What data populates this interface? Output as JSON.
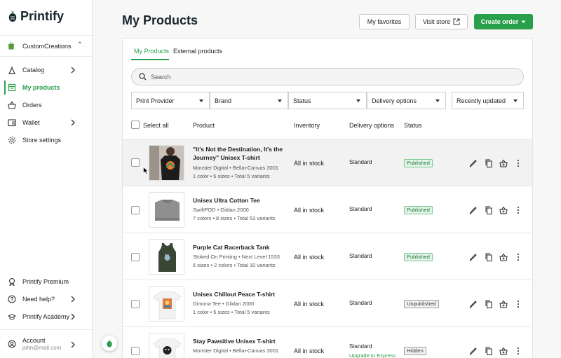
{
  "app": {
    "logo_text": "Printify"
  },
  "sidebar": {
    "store_name": "CustomCreations",
    "items": [
      {
        "label": "Catalog",
        "icon": "catalog-icon",
        "has_chevron": true
      },
      {
        "label": "My products",
        "icon": "products-icon",
        "active": true
      },
      {
        "label": "Orders",
        "icon": "basket-icon"
      },
      {
        "label": "Wallet",
        "icon": "wallet-icon",
        "has_chevron": true
      },
      {
        "label": "Store settings",
        "icon": "gear-icon"
      }
    ],
    "bottom_items": [
      {
        "label": "Printify Premium",
        "icon": "premium-icon"
      },
      {
        "label": "Need help?",
        "icon": "help-icon",
        "has_chevron": true
      },
      {
        "label": "Printify Academy",
        "icon": "academy-icon",
        "has_chevron": true
      }
    ],
    "account": {
      "label": "Account",
      "email": "john@mail.com"
    }
  },
  "header": {
    "title": "My Products",
    "favorites_label": "My favorites",
    "visit_store_label": "Visit store",
    "create_order_label": "Create order"
  },
  "tabs": [
    {
      "label": "My Products",
      "active": true
    },
    {
      "label": "External products"
    }
  ],
  "search": {
    "placeholder": "Search"
  },
  "filters": [
    "Print Provider",
    "Brand",
    "Status",
    "Delivery options"
  ],
  "sort": {
    "value": "Recently updated"
  },
  "table": {
    "select_all_label": "Select all",
    "columns": [
      "Product",
      "Inventory",
      "Delivery options",
      "Status"
    ],
    "rows": [
      {
        "name_line1": "\"It's Not the Destination, It's the",
        "name_line2": "Journey\" Unisex T-shirt",
        "provider": "Monster Digital • Bella+Canvas 3001",
        "variants": "1 color • 5 sizes • Total 5 variants",
        "inventory": "All in stock",
        "delivery": "Standard",
        "status": "Published",
        "status_kind": "pub",
        "thumb": "person-tshirt"
      },
      {
        "name_line1": "Unisex Ultra Cotton Tee",
        "provider": "SwiftPOD • Gildan 2000",
        "variants": "7 colors • 8 sizes • Total 53 variants",
        "inventory": "All in stock",
        "delivery": "Standard",
        "status": "Published",
        "status_kind": "pub",
        "thumb": "gray-folded-tee"
      },
      {
        "name_line1": "Purple Cat Racerback Tank",
        "provider": "Stoked On Printing • Next Level 1533",
        "variants": "6 sizes • 2 colors • Total 10 variants",
        "inventory": "All in stock",
        "delivery": "Standard",
        "status": "Published",
        "status_kind": "pub",
        "thumb": "green-tank"
      },
      {
        "name_line1": "Unisex Chillout Peace T-shirt",
        "provider": "Dimona Tee • Gildan 2000",
        "variants": "1 color • 5 sizes • Total 5 variants",
        "inventory": "All in stock",
        "delivery": "Standard",
        "status": "Unpublished",
        "status_kind": "unpub",
        "thumb": "white-tee-print"
      },
      {
        "name_line1": "Stay Pawsitive Unisex T-shirt",
        "provider": "Monster Digital • Bella+Canvas 3001",
        "variants": "",
        "inventory": "All in stock",
        "delivery": "Standard",
        "upgrade": "Upgrade to Express",
        "status": "Hidden",
        "status_kind": "hidden",
        "thumb": "white-tee-dog"
      }
    ]
  },
  "colors": {
    "accent": "#29a04b",
    "title": "#17262b"
  }
}
